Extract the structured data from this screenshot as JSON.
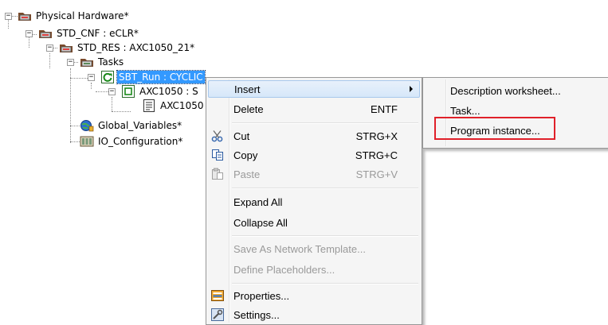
{
  "tree": {
    "physical_hardware": "Physical Hardware*",
    "std_cnf": "STD_CNF : eCLR*",
    "std_res": "STD_RES : AXC1050_21*",
    "tasks": "Tasks",
    "sbt_run": "SBT_Run : CYCLIC",
    "axc1050_s": "AXC1050 : S",
    "axc1050_child": "AXC1050",
    "global_variables": "Global_Variables*",
    "io_configuration": "IO_Configuration*"
  },
  "context_menu": {
    "insert": "Insert",
    "delete": "Delete",
    "delete_shortcut": "ENTF",
    "cut": "Cut",
    "cut_shortcut": "STRG+X",
    "copy": "Copy",
    "copy_shortcut": "STRG+C",
    "paste": "Paste",
    "paste_shortcut": "STRG+V",
    "expand_all": "Expand All",
    "collapse_all": "Collapse All",
    "save_as_network_template": "Save As Network Template...",
    "define_placeholders": "Define Placeholders...",
    "properties": "Properties...",
    "settings": "Settings..."
  },
  "submenu": {
    "description_worksheet": "Description worksheet...",
    "task": "Task...",
    "program_instance": "Program instance..."
  },
  "colors": {
    "selection": "#3399ff",
    "menu_highlight": "#d6e7f9",
    "callout_box": "#e0202a"
  }
}
